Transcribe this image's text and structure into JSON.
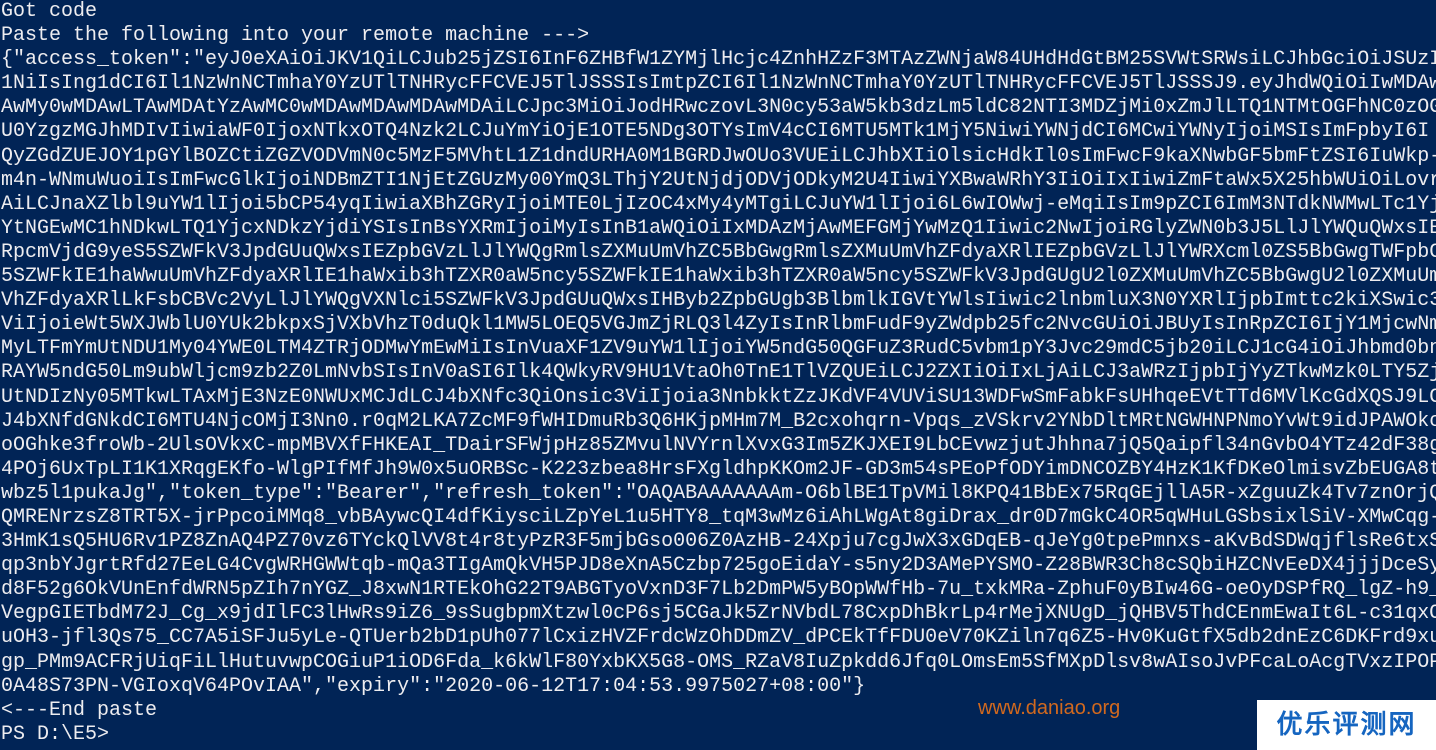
{
  "terminal": {
    "lines": [
      "Got code",
      "Paste the following into your remote machine --->",
      "{\"access_token\":\"eyJ0eXAiOiJKV1QiLCJub25jZSI6InF6ZHBfW1ZYMjlHcjc4ZnhHZzF3MTAzZWNjaW84UHdHdGtBM25SVWtSRWsiLCJhbGciOiJSUzI",
      "1NiIsIng1dCI6Il1NzWnNCTmhaY0YzUTlTNHRycFFCVEJ5TlJSSSIsImtpZCI6Il1NzWnNCTmhaY0YzUTlTNHRycFFCVEJ5TlJSSSJ9.eyJhdWQiOiIwMDAwMD",
      "AwMy0wMDAwLTAwMDAtYzAwMC0wMDAwMDAwMDAwMDAiLCJpc3MiOiJodHRwczovL3N0cy53aW5kb3dzLm5ldC82NTI3MDZjMi0xZmJlLTQ1NTMtOGFhNC0zOG",
      "U0YzgzMGJhMDIvIiwiaWF0IjoxNTkxOTQ4Nzk2LCJuYmYiOjE1OTE5NDg3OTYsImV4cCI6MTU5MTk1MjY5NiwiYWNjdCI6MCwiYWNyIjoiMSIsImFpbyI6I",
      "QyZGdZUEJOY1pGYlBOZCtiZGZVODVmN0c5MzF5MVhtL1Z1dndURHA0M1BGRDJwOUo3VUEiLCJhbXIiOlsicHdkIl0sImFwcF9kaXNwbGF5bmFtZSI6IuWkp-",
      "m4n-WNmuWuoiIsImFwcGlkIjoiNDBmZTI1NjEtZGUzMy00YmQ3LThjY2UtNjdjODVjODkyM2U4IiwiYXBwaWRhY3IiOiIxIiwiZmFtaWx5X25hbWUiOiLovr",
      "AiLCJnaXZlbl9uYW1lIjoi5bCP54yqIiwiaXBhZGRyIjoiMTE0LjIzOC4xMy4yMTgiLCJuYW1lIjoi6L6wIOWwj-eMqiIsIm9pZCI6ImM3NTdkNWMwLTc1Yj",
      "YtNGEwMC1hNDkwLTQ1YjcxNDkzYjdiYSIsInBsYXRmIjoiMyIsInB1aWQiOiIxMDAzMjAwMEFGMjYwMzQ1Iiwic2NwIjoiRGlyZWN0b3J5LlJlYWQuQWxsIE",
      "RpcmVjdG9yeS5SZWFkV3JpdGUuQWxsIEZpbGVzLlJlYWQgRmlsZXMuUmVhZC5BbGwgRmlsZXMuUmVhZFdyaXRlIEZpbGVzLlJlYWRXcml0ZS5BbGwgTWFpbC",
      "5SZWFkIE1haWwuUmVhZFdyaXRlIE1haWxib3hTZXR0aW5ncy5SZWFkIE1haWxib3hTZXR0aW5ncy5SZWFkV3JpdGUgU2l0ZXMuUmVhZC5BbGwgU2l0ZXMuUm",
      "VhZFdyaXRlLkFsbCBVc2VyLlJlYWQgVXNlci5SZWFkV3JpdGUuQWxsIHByb2ZpbGUgb3BlbmlkIGVtYWlsIiwic2lnbmluX3N0YXRlIjpbImttc2kiXSwic3",
      "ViIjoieWt5WXJWblU0YUk2bkpxSjVXbVhzT0duQkl1MW5LOEQ5VGJmZjRLQ3l4ZyIsInRlbmFudF9yZWdpb25fc2NvcGUiOiJBUyIsInRpZCI6IjY1MjcwNm",
      "MyLTFmYmUtNDU1My04YWE0LTM4ZTRjODMwYmEwMiIsInVuaXF1ZV9uYW1lIjoiYW5ndG50QGFuZ3RudC5vbm1pY3Jvc29mdC5jb20iLCJ1cG4iOiJhbmd0bn",
      "RAYW5ndG50Lm9ubWljcm9zb2Z0LmNvbSIsInV0aSI6Ilk4QWkyRV9HU1VtaOh0TnE1TlVZQUEiLCJ2ZXIiOiIxLjAiLCJ3aWRzIjpbIjYyZTkwMzk0LTY5Zj",
      "UtNDIzNy05MTkwLTAxMjE3NzE0NWUxMCJdLCJ4bXNfc3QiOnsic3ViIjoia3NnbkktZzJKdVF4VUViSU13WDFwSmFabkFsUHhqeEVtTTd6MVlKcGdXQSJ9LC",
      "J4bXNfdGNkdCI6MTU4NjcOMjI3Nn0.r0qM2LKA7ZcMF9fWHIDmuRb3Q6HKjpMHm7M_B2cxohqrn-Vpqs_zVSkrv2YNbDltMRtNGWHNPNmoYvWt9idJPAWOkc",
      "oOGhke3froWb-2UlsOVkxC-mpMBVXfFHKEAI_TDairSFWjpHz85ZMvulNVYrnlXvxG3Im5ZKJXEI9LbCEvwzjutJhhna7jQ5Qaipfl34nGvbO4YTz42dF38g",
      "4POj6UxTpLI1K1XRqgEKfo-WlgPIfMfJh9W0x5uORBSc-K223zbea8HrsFXgldhpKKOm2JF-GD3m54sPEoPfODYimDNCOZBY4HzK1KfDKeOlmisvZbEUGA8t",
      "wbz5l1pukaJg\",\"token_type\":\"Bearer\",\"refresh_token\":\"OAQABAAAAAAAm-O6blBE1TpVMil8KPQ41BbEx75RqGEjllA5R-xZguuZk4Tv7znOrjQ",
      "QMRENrzsZ8TRT5X-jrPpcoiMMq8_vbBAywcQI4dfKiysciLZpYeL1u5HTY8_tqM3wMz6iAhLWgAt8giDrax_dr0D7mGkC4OR5qWHuLGSbsixlSiV-XMwCqg-",
      "3HmK1sQ5HU6Rv1PZ8ZnAQ4PZ70vz6TYckQlVV8t4r8tyPzR3F5mjbGso006Z0AzHB-24Xpju7cgJwX3xGDqEB-qJeYg0tpePmnxs-aKvBdSDWqjflsRe6txS",
      "qp3nbYJgrtRfd27EeLG4CvgWRHGWWtqb-mQa3TIgAmQkVH5PJD8eXnA5Czbp725goEidaY-s5ny2D3AMePYSMO-Z28BWR3Ch8cSQbiHZCNvEeDX4jjjDceSy",
      "d8F52g6OkVUnEnfdWRN5pZIh7nYGZ_J8xwN1RTEkOhG22T9ABGTyoVxnD3F7Lb2DmPW5yBOpWWfHb-7u_txkMRa-ZphuF0yBIw46G-oeOyDSPfRQ_lgZ-h9_",
      "VegpGIETbdM72J_Cg_x9jdIlFC3lHwRs9iZ6_9sSugbpmXtzwl0cP6sj5CGaJk5ZrNVbdL78CxpDhBkrLp4rMejXNUgD_jQHBV5ThdCEnmEwaIt6L-c31qxO",
      "uOH3-jfl3Qs75_CC7A5iSFJu5yLe-QTUerb2bD1pUh077lCxizHVZFrdcWzOhDDmZV_dPCEkTfFDU0eV70KZiln7q6Z5-Hv0KuGtfX5db2dnEzC6DKFrd9xu",
      "gp_PMm9ACFRjUiqFiLlHutuvwpCOGiuP1iOD6Fda_k6kWlF80YxbKX5G8-OMS_RZaV8IuZpkdd6Jfq0LOmsEm5SfMXpDlsv8wAIsoJvPFcaLoAcgTVxzIPOP",
      "0A48S73PN-VGIoxqV64POvIAA\",\"expiry\":\"2020-06-12T17:04:53.9975027+08:00\"}",
      "<---End paste",
      "PS D:\\E5>"
    ]
  },
  "watermark": {
    "text": "www.daniao.org"
  },
  "logo": {
    "text": "优乐评测网"
  }
}
